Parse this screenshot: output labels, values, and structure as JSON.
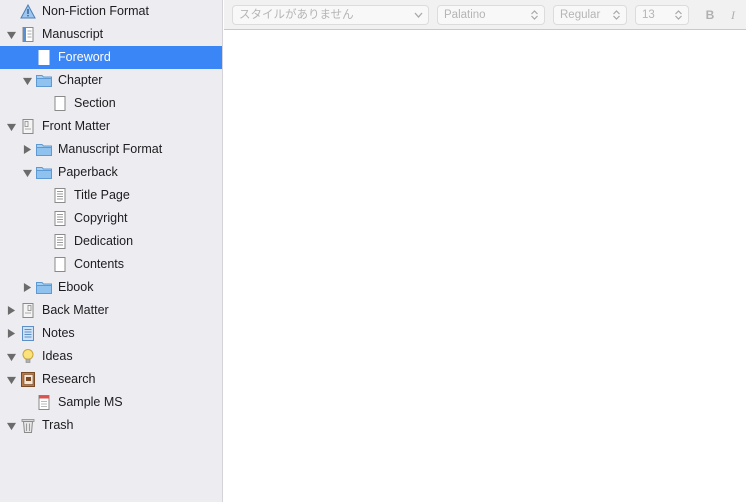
{
  "binder": {
    "items": [
      {
        "label": "Non-Fiction Format"
      },
      {
        "label": "Manuscript"
      },
      {
        "label": "Foreword"
      },
      {
        "label": "Chapter"
      },
      {
        "label": "Section"
      },
      {
        "label": "Front Matter"
      },
      {
        "label": "Manuscript Format"
      },
      {
        "label": "Paperback"
      },
      {
        "label": "Title Page"
      },
      {
        "label": "Copyright"
      },
      {
        "label": "Dedication"
      },
      {
        "label": "Contents"
      },
      {
        "label": "Ebook"
      },
      {
        "label": "Back Matter"
      },
      {
        "label": "Notes"
      },
      {
        "label": "Ideas"
      },
      {
        "label": "Research"
      },
      {
        "label": "Sample MS"
      },
      {
        "label": "Trash"
      }
    ]
  },
  "formatbar": {
    "style_placeholder": "スタイルがありません",
    "font_family": "Palatino",
    "font_style": "Regular",
    "font_size": "13",
    "bold": "B",
    "italic": "I"
  },
  "colors": {
    "selection": "#3b86f7",
    "sidebar_bg": "#ececf1",
    "folder": "#7fb6e6"
  }
}
